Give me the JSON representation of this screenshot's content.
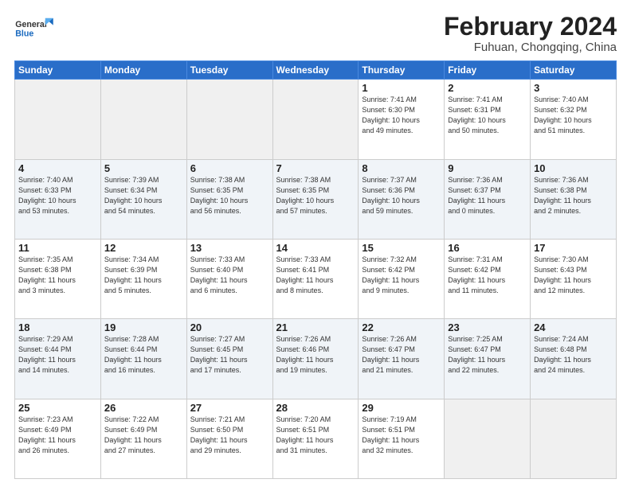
{
  "header": {
    "logo_general": "General",
    "logo_blue": "Blue",
    "title": "February 2024",
    "subtitle": "Fuhuan, Chongqing, China"
  },
  "weekdays": [
    "Sunday",
    "Monday",
    "Tuesday",
    "Wednesday",
    "Thursday",
    "Friday",
    "Saturday"
  ],
  "weeks": [
    [
      {
        "day": "",
        "info": ""
      },
      {
        "day": "",
        "info": ""
      },
      {
        "day": "",
        "info": ""
      },
      {
        "day": "",
        "info": ""
      },
      {
        "day": "1",
        "info": "Sunrise: 7:41 AM\nSunset: 6:30 PM\nDaylight: 10 hours\nand 49 minutes."
      },
      {
        "day": "2",
        "info": "Sunrise: 7:41 AM\nSunset: 6:31 PM\nDaylight: 10 hours\nand 50 minutes."
      },
      {
        "day": "3",
        "info": "Sunrise: 7:40 AM\nSunset: 6:32 PM\nDaylight: 10 hours\nand 51 minutes."
      }
    ],
    [
      {
        "day": "4",
        "info": "Sunrise: 7:40 AM\nSunset: 6:33 PM\nDaylight: 10 hours\nand 53 minutes."
      },
      {
        "day": "5",
        "info": "Sunrise: 7:39 AM\nSunset: 6:34 PM\nDaylight: 10 hours\nand 54 minutes."
      },
      {
        "day": "6",
        "info": "Sunrise: 7:38 AM\nSunset: 6:35 PM\nDaylight: 10 hours\nand 56 minutes."
      },
      {
        "day": "7",
        "info": "Sunrise: 7:38 AM\nSunset: 6:35 PM\nDaylight: 10 hours\nand 57 minutes."
      },
      {
        "day": "8",
        "info": "Sunrise: 7:37 AM\nSunset: 6:36 PM\nDaylight: 10 hours\nand 59 minutes."
      },
      {
        "day": "9",
        "info": "Sunrise: 7:36 AM\nSunset: 6:37 PM\nDaylight: 11 hours\nand 0 minutes."
      },
      {
        "day": "10",
        "info": "Sunrise: 7:36 AM\nSunset: 6:38 PM\nDaylight: 11 hours\nand 2 minutes."
      }
    ],
    [
      {
        "day": "11",
        "info": "Sunrise: 7:35 AM\nSunset: 6:38 PM\nDaylight: 11 hours\nand 3 minutes."
      },
      {
        "day": "12",
        "info": "Sunrise: 7:34 AM\nSunset: 6:39 PM\nDaylight: 11 hours\nand 5 minutes."
      },
      {
        "day": "13",
        "info": "Sunrise: 7:33 AM\nSunset: 6:40 PM\nDaylight: 11 hours\nand 6 minutes."
      },
      {
        "day": "14",
        "info": "Sunrise: 7:33 AM\nSunset: 6:41 PM\nDaylight: 11 hours\nand 8 minutes."
      },
      {
        "day": "15",
        "info": "Sunrise: 7:32 AM\nSunset: 6:42 PM\nDaylight: 11 hours\nand 9 minutes."
      },
      {
        "day": "16",
        "info": "Sunrise: 7:31 AM\nSunset: 6:42 PM\nDaylight: 11 hours\nand 11 minutes."
      },
      {
        "day": "17",
        "info": "Sunrise: 7:30 AM\nSunset: 6:43 PM\nDaylight: 11 hours\nand 12 minutes."
      }
    ],
    [
      {
        "day": "18",
        "info": "Sunrise: 7:29 AM\nSunset: 6:44 PM\nDaylight: 11 hours\nand 14 minutes."
      },
      {
        "day": "19",
        "info": "Sunrise: 7:28 AM\nSunset: 6:44 PM\nDaylight: 11 hours\nand 16 minutes."
      },
      {
        "day": "20",
        "info": "Sunrise: 7:27 AM\nSunset: 6:45 PM\nDaylight: 11 hours\nand 17 minutes."
      },
      {
        "day": "21",
        "info": "Sunrise: 7:26 AM\nSunset: 6:46 PM\nDaylight: 11 hours\nand 19 minutes."
      },
      {
        "day": "22",
        "info": "Sunrise: 7:26 AM\nSunset: 6:47 PM\nDaylight: 11 hours\nand 21 minutes."
      },
      {
        "day": "23",
        "info": "Sunrise: 7:25 AM\nSunset: 6:47 PM\nDaylight: 11 hours\nand 22 minutes."
      },
      {
        "day": "24",
        "info": "Sunrise: 7:24 AM\nSunset: 6:48 PM\nDaylight: 11 hours\nand 24 minutes."
      }
    ],
    [
      {
        "day": "25",
        "info": "Sunrise: 7:23 AM\nSunset: 6:49 PM\nDaylight: 11 hours\nand 26 minutes."
      },
      {
        "day": "26",
        "info": "Sunrise: 7:22 AM\nSunset: 6:49 PM\nDaylight: 11 hours\nand 27 minutes."
      },
      {
        "day": "27",
        "info": "Sunrise: 7:21 AM\nSunset: 6:50 PM\nDaylight: 11 hours\nand 29 minutes."
      },
      {
        "day": "28",
        "info": "Sunrise: 7:20 AM\nSunset: 6:51 PM\nDaylight: 11 hours\nand 31 minutes."
      },
      {
        "day": "29",
        "info": "Sunrise: 7:19 AM\nSunset: 6:51 PM\nDaylight: 11 hours\nand 32 minutes."
      },
      {
        "day": "",
        "info": ""
      },
      {
        "day": "",
        "info": ""
      }
    ]
  ]
}
